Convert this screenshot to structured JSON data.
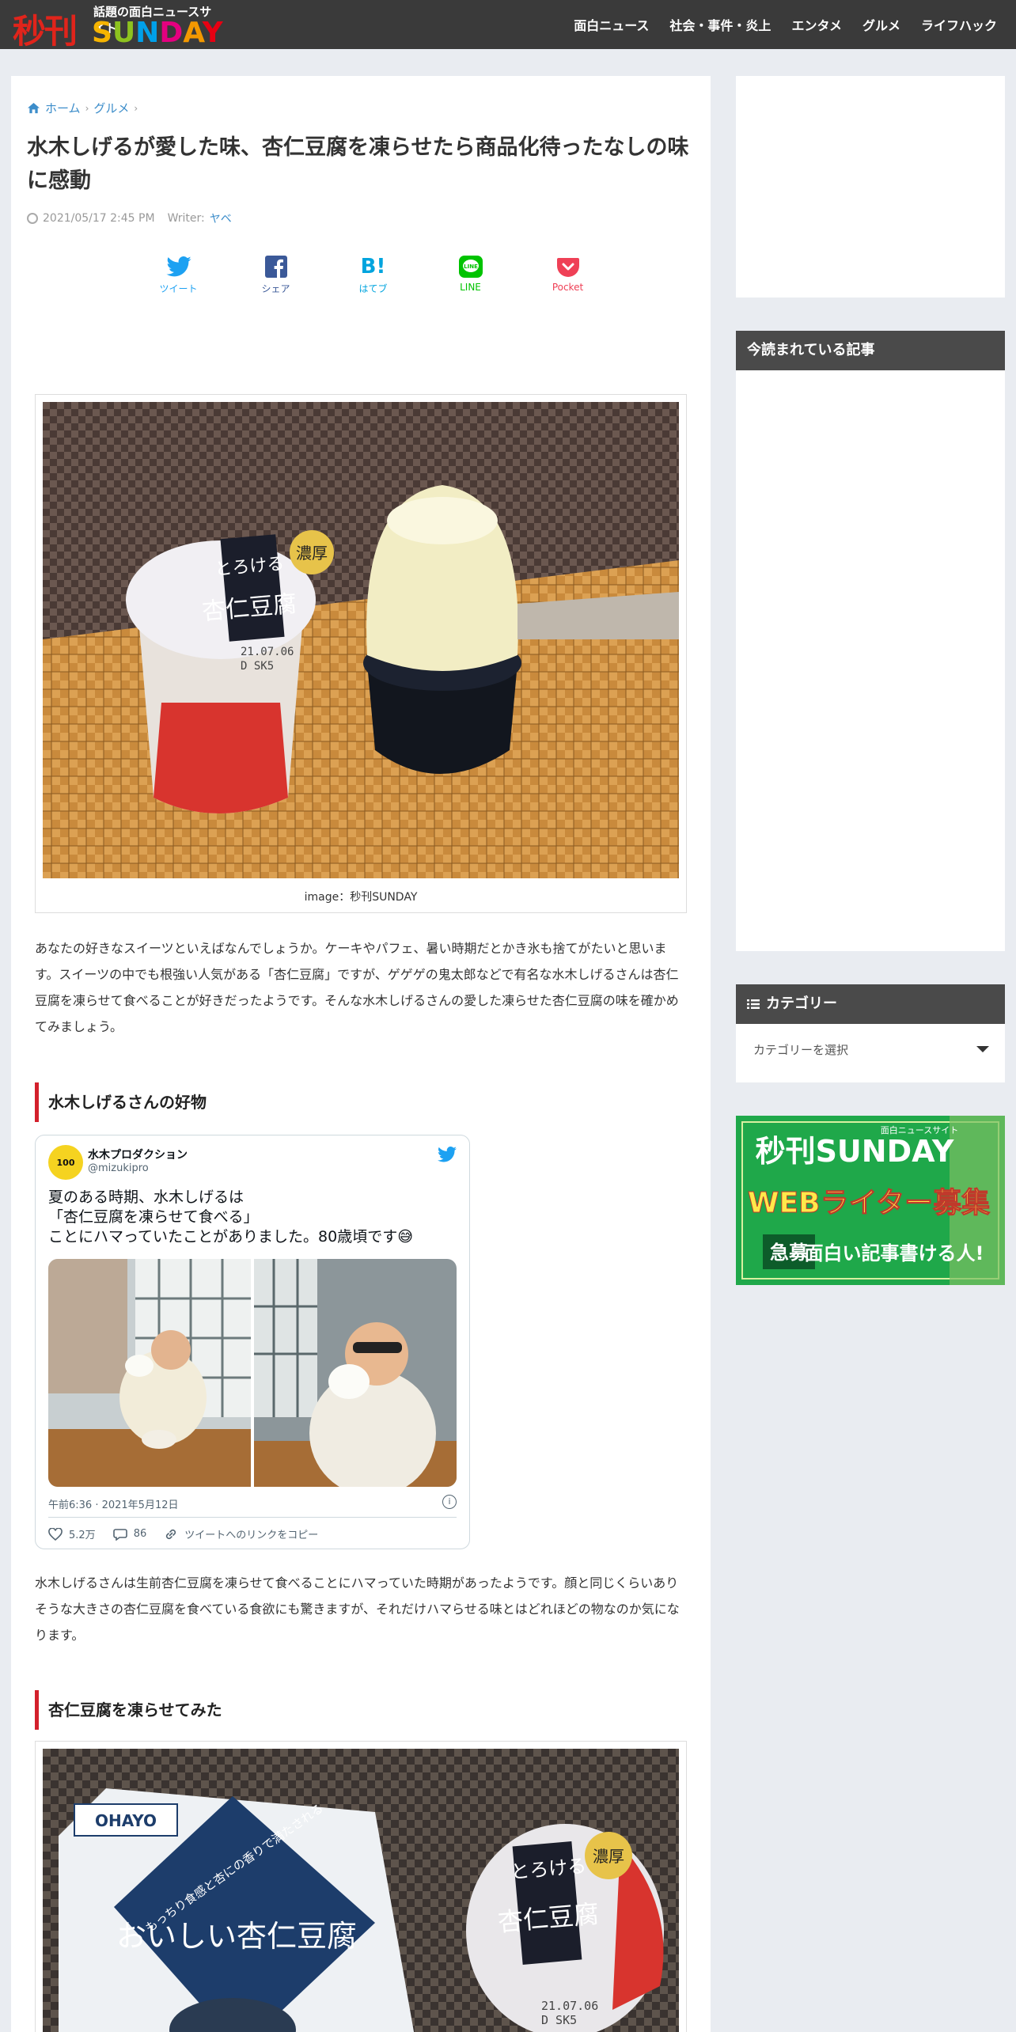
{
  "header": {
    "logo_kanji": "秒刊",
    "logo_tagline": "話題の面白ニュースサイト",
    "logo_letters": [
      "S",
      "U",
      "N",
      "D",
      "A",
      "Y"
    ],
    "nav": [
      "面白ニュース",
      "社会・事件・炎上",
      "エンタメ",
      "グルメ",
      "ライフハック"
    ]
  },
  "breadcrumb": {
    "home": "ホーム",
    "category": "グルメ"
  },
  "article": {
    "title": "水木しげるが愛した味、杏仁豆腐を凍らせたら商品化待ったなしの味に感動",
    "date": "2021/05/17 2:45 PM",
    "writer_label": "Writer:",
    "writer_name": "ヤベ",
    "share": [
      {
        "label": "ツイート",
        "icon": "twitter-icon"
      },
      {
        "label": "シェア",
        "icon": "facebook-icon"
      },
      {
        "label": "はてブ",
        "icon": "hatena-icon"
      },
      {
        "label": "LINE",
        "icon": "line-icon"
      },
      {
        "label": "Pocket",
        "icon": "pocket-icon"
      }
    ],
    "image_caption": "image：秒刊SUNDAY",
    "photo1_text": {
      "brand": "とろける",
      "product": "杏仁豆腐",
      "badge": "濃厚",
      "date": "21.07.06",
      "code": "D   SK5"
    },
    "intro": "あなたの好きなスイーツといえばなんでしょうか。ケーキやパフェ、暑い時期だとかき氷も捨てがたいと思います。スイーツの中でも根強い人気がある「杏仁豆腐」ですが、ゲゲゲの鬼太郎などで有名な水木しげるさんは杏仁豆腐を凍らせて食べることが好きだったようです。そんな水木しげるさんの愛した凍らせた杏仁豆腐の味を確かめてみましょう。",
    "heading1": "水木しげるさんの好物",
    "tweet": {
      "avatar_text": "100",
      "name": "水木プロダクション",
      "handle": "@mizukipro",
      "line1": "夏のある時期、水木しげるは",
      "line2": "「杏仁豆腐を凍らせて食べる」",
      "line3": "ことにハマっていたことがありました。80歳頃です😅",
      "time": "午前6:36 · 2021年5月12日",
      "likes": "5.2万",
      "replies": "86",
      "copy_link": "ツイートへのリンクをコピー"
    },
    "para2": "水木しげるさんは生前杏仁豆腐を凍らせて食べることにハマっていた時期があったようです。顔と同じくらいありそうな大きさの杏仁豆腐を食べている食欲にも驚きますが、それだけハマらせる味とはどれほどの物なのか気になります。",
    "heading2": "杏仁豆腐を凍らせてみた",
    "photo2_text": {
      "brand": "OHAYO",
      "product": "おいしい杏仁豆腐",
      "tagline": "もっちり食感と杏にの香りで満たされる",
      "cup_brand": "とろける",
      "cup_product": "杏仁豆腐",
      "badge": "濃厚",
      "date": "21.07.06",
      "code": "D   SK5"
    }
  },
  "sidebar": {
    "popular_heading": "今読まれている記事",
    "category_heading": "カテゴリー",
    "category_select": "カテゴリーを選択",
    "banner": {
      "logo": "秒刊SUNDAY",
      "tagline": "面白ニュースサイト",
      "headline": "WEBライター募集",
      "urgent": "急募",
      "sub": "面白い記事書ける人!"
    }
  },
  "colors": {
    "accent_red": "#d3202c",
    "link_blue": "#3c8dca",
    "header_bg": "#3a3a3a",
    "sidebar_head": "#4a4a4a"
  }
}
